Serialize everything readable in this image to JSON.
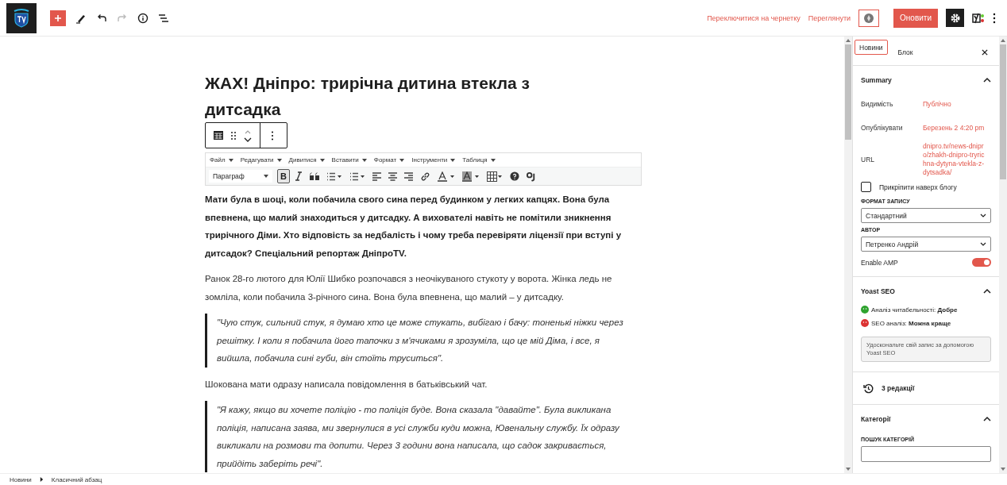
{
  "toolbar": {
    "tools": [
      {
        "kind": "add"
      },
      {
        "kind": "edit"
      },
      {
        "kind": "undo",
        "disabled": false
      },
      {
        "kind": "redo",
        "disabled": true
      },
      {
        "kind": "info"
      },
      {
        "kind": "outline"
      }
    ],
    "links": [
      "Переключитися на чернетку",
      "Переглянути"
    ],
    "update": "Оновити"
  },
  "post": {
    "title": "ЖАХ! Дніпро: трирічна дитина втекла з дитсадка",
    "menus": [
      "Файл",
      "Редагувати",
      "Дивитися",
      "Вставити",
      "Формат",
      "Інструменти",
      "Таблиця"
    ],
    "format": "Параграф",
    "tools": [
      {
        "kind": "bold",
        "label": "B",
        "selected": true
      },
      {
        "kind": "italic",
        "selected": false
      },
      {
        "kind": "quote",
        "selected": false
      },
      {
        "kind": "ul",
        "selected": false
      },
      {
        "kind": "ol",
        "selected": false
      },
      {
        "kind": "left",
        "selected": false
      },
      {
        "kind": "center",
        "selected": false
      },
      {
        "kind": "right",
        "selected": false
      },
      {
        "kind": "link",
        "selected": false
      },
      {
        "kind": "textcolor",
        "selected": false
      },
      {
        "kind": "bgcolor",
        "selected": false
      },
      {
        "kind": "table",
        "selected": false
      },
      {
        "kind": "help",
        "selected": false
      },
      {
        "kind": "special",
        "selected": false
      }
    ],
    "paragraphs": [
      {
        "kind": "lead",
        "text": "Мати була в шоці, коли побачила свого сина перед будинком у легких капцях. Вона була впевнена, що малий знаходиться у дитсадку. А вихователі навіть не помітили зникнення трирічного Діми. Хто відповість за недбалість і чому треба перевіряти ліцензії при вступі у дитсадок? Спеціальний репортаж ДніпроTV."
      },
      {
        "kind": "text",
        "text": "Ранок 28-го лютого для Юлії Шибко розпочався з неочікуваного стукоту у ворота. Жінка ледь не зомліла, коли побачила 3-річного сина. Вона була впевнена, що малий – у дитсадку."
      },
      {
        "kind": "quote",
        "text": "\"Чую стук, сильний стук, я думаю хто це може стукать, вибігаю і бачу: тоненькі ніжки через решітку. І коли я побачила його тапочки з м'ячиками я зрозуміла, що це мій Діма, і все, я вийшла, побачила сині губи, він стоїть труситься\"."
      },
      {
        "kind": "text",
        "text": "Шокована мати одразу написала повідомлення в батьківський чат."
      },
      {
        "kind": "quote",
        "text": "\"Я кажу, якщо ви хочете поліцію - то поліція буде. Вона сказала \"давайте\". Була викликана поліція, написана заява, ми звернулися в усі служби куди можна, Ювенальну службу. Їх одразу викликали на розмови та допити. Через 3 години вона написала, що садок закривається, прийдіть заберіть речі\"."
      }
    ]
  },
  "sidebar": {
    "tabs": [
      {
        "label": "Новини",
        "selected": true
      },
      {
        "label": "Блок",
        "selected": false
      }
    ],
    "summary": {
      "title": "Summary",
      "expanded": true,
      "rows": [
        {
          "label": "Видимість",
          "value": "Публічно"
        },
        {
          "label": "Опублікувати",
          "value": "Березень 2 4:20 pm"
        },
        {
          "label": "URL",
          "value": "dnipro.tv/news-dnipro/zhakh-dnipro-tryrichna-dytyna-vtekla-z-dytsadka/"
        }
      ],
      "sticky": {
        "label": "Прикріпити наверх блогу",
        "checked": false
      },
      "selects": [
        {
          "label": "ФОРМАТ ЗАПИСУ",
          "value": "Стандартний"
        },
        {
          "label": "АВТОР",
          "value": "Петренко Андрій"
        }
      ],
      "amp": {
        "label": "Enable AMP",
        "on": true
      }
    },
    "yoast": {
      "title": "Yoast SEO",
      "expanded": true,
      "results": [
        {
          "text": "Аналіз читабельності: **Добре**",
          "color": "#2fa32f"
        },
        {
          "text": "SEO аналіз: **Можна краще**",
          "color": "#dc3232"
        }
      ],
      "button": "Удоскональте свій запис за допомогою Yoast SEO"
    },
    "revisions": "3 редакції",
    "categories": {
      "title": "Категорії",
      "expanded": true,
      "search_label": "ПОШУК КАТЕГОРІЙ"
    }
  },
  "breadcrumb": [
    "Новини",
    "Класичний абзац"
  ]
}
